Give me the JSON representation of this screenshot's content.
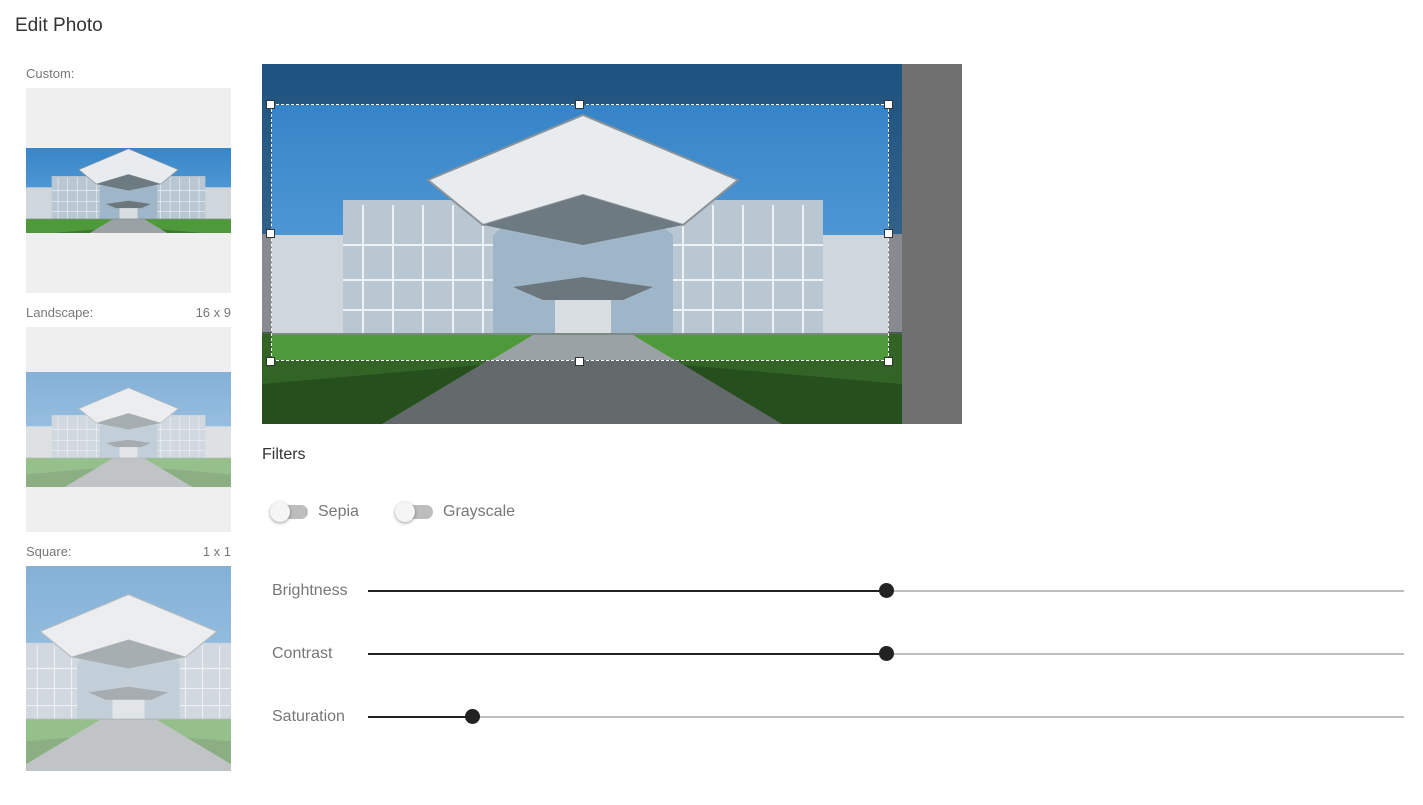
{
  "page": {
    "title": "Edit Photo"
  },
  "presets": [
    {
      "label": "Custom:",
      "ratio": ""
    },
    {
      "label": "Landscape:",
      "ratio": "16 x 9"
    },
    {
      "label": "Square:",
      "ratio": "1 x 1"
    }
  ],
  "filters": {
    "title": "Filters",
    "toggles": [
      {
        "label": "Sepia",
        "on": false
      },
      {
        "label": "Grayscale",
        "on": false
      }
    ],
    "sliders": [
      {
        "label": "Brightness",
        "value": 0.5
      },
      {
        "label": "Contrast",
        "value": 0.5
      },
      {
        "label": "Saturation",
        "value": 0.1
      }
    ]
  }
}
